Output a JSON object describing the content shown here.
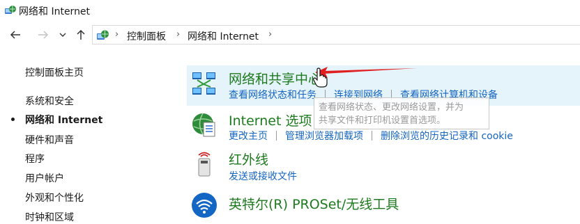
{
  "window": {
    "title": "网络和 Internet"
  },
  "nav": {
    "back_icon": "arrow-left-icon",
    "forward_icon": "arrow-right-icon",
    "recent_icon": "chevron-down-icon",
    "up_icon": "arrow-up-icon"
  },
  "address": {
    "crumbs": [
      "控制面板",
      "网络和 Internet"
    ],
    "separator": "›"
  },
  "sidebar": {
    "items": [
      {
        "label": "控制面板主页",
        "current": false
      },
      {
        "label": "系统和安全",
        "current": false
      },
      {
        "label": "网络和 Internet",
        "current": true
      },
      {
        "label": "硬件和声音",
        "current": false
      },
      {
        "label": "程序",
        "current": false
      },
      {
        "label": "用户帐户",
        "current": false
      },
      {
        "label": "外观和个性化",
        "current": false
      },
      {
        "label": "时钟和区域",
        "current": false
      }
    ]
  },
  "categories": [
    {
      "title": "网络和共享中心",
      "icon": "network-sharing-icon",
      "links": [
        "查看网络状态和任务",
        "连接到网络",
        "查看网络计算机和设备"
      ]
    },
    {
      "title": "Internet 选项",
      "icon": "internet-options-icon",
      "links": [
        "更改主页",
        "管理浏览器加载项",
        "删除浏览的历史记录和 cookie"
      ]
    },
    {
      "title": "红外线",
      "icon": "infrared-icon",
      "links": [
        "发送或接收文件"
      ]
    },
    {
      "title": "英特尔(R) PROSet/无线工具",
      "icon": "wireless-icon",
      "links": []
    }
  ],
  "tooltip": {
    "line1": "查看网络状态、更改网络设置，并为",
    "line2": "共享文件和打印机设置首选项。"
  },
  "colors": {
    "link": "#1565c0",
    "title_green": "#1e7a1e",
    "hover_bg": "#e5f3fb",
    "annotation_red": "#e02020"
  }
}
